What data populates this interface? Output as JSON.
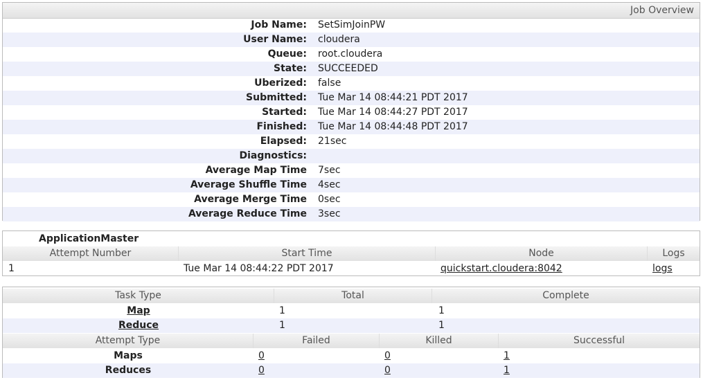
{
  "overview": {
    "title": "Job Overview",
    "rows": [
      {
        "label": "Job Name:",
        "value": "SetSimJoinPW"
      },
      {
        "label": "User Name:",
        "value": "cloudera"
      },
      {
        "label": "Queue:",
        "value": "root.cloudera"
      },
      {
        "label": "State:",
        "value": "SUCCEEDED"
      },
      {
        "label": "Uberized:",
        "value": "false"
      },
      {
        "label": "Submitted:",
        "value": "Tue Mar 14 08:44:21 PDT 2017"
      },
      {
        "label": "Started:",
        "value": "Tue Mar 14 08:44:27 PDT 2017"
      },
      {
        "label": "Finished:",
        "value": "Tue Mar 14 08:44:48 PDT 2017"
      },
      {
        "label": "Elapsed:",
        "value": "21sec"
      },
      {
        "label": "Diagnostics:",
        "value": ""
      },
      {
        "label": "Average Map Time",
        "value": "7sec"
      },
      {
        "label": "Average Shuffle Time",
        "value": "4sec"
      },
      {
        "label": "Average Merge Time",
        "value": "0sec"
      },
      {
        "label": "Average Reduce Time",
        "value": "3sec"
      }
    ]
  },
  "app_master": {
    "title": "ApplicationMaster",
    "headers": [
      "Attempt Number",
      "Start Time",
      "Node",
      "Logs"
    ],
    "row": {
      "attempt": "1",
      "start_time": "Tue Mar 14 08:44:22 PDT 2017",
      "node": "quickstart.cloudera:8042",
      "logs": "logs"
    }
  },
  "tasks": {
    "headers": [
      "Task Type",
      "Total",
      "Complete"
    ],
    "rows": [
      {
        "type": "Map",
        "total": "1",
        "complete": "1"
      },
      {
        "type": "Reduce",
        "total": "1",
        "complete": "1"
      }
    ],
    "attempt_headers": [
      "Attempt Type",
      "Failed",
      "Killed",
      "Successful"
    ],
    "attempt_rows": [
      {
        "type": "Maps",
        "failed": "0",
        "killed": "0",
        "successful": "1"
      },
      {
        "type": "Reduces",
        "failed": "0",
        "killed": "0",
        "successful": "1"
      }
    ]
  }
}
